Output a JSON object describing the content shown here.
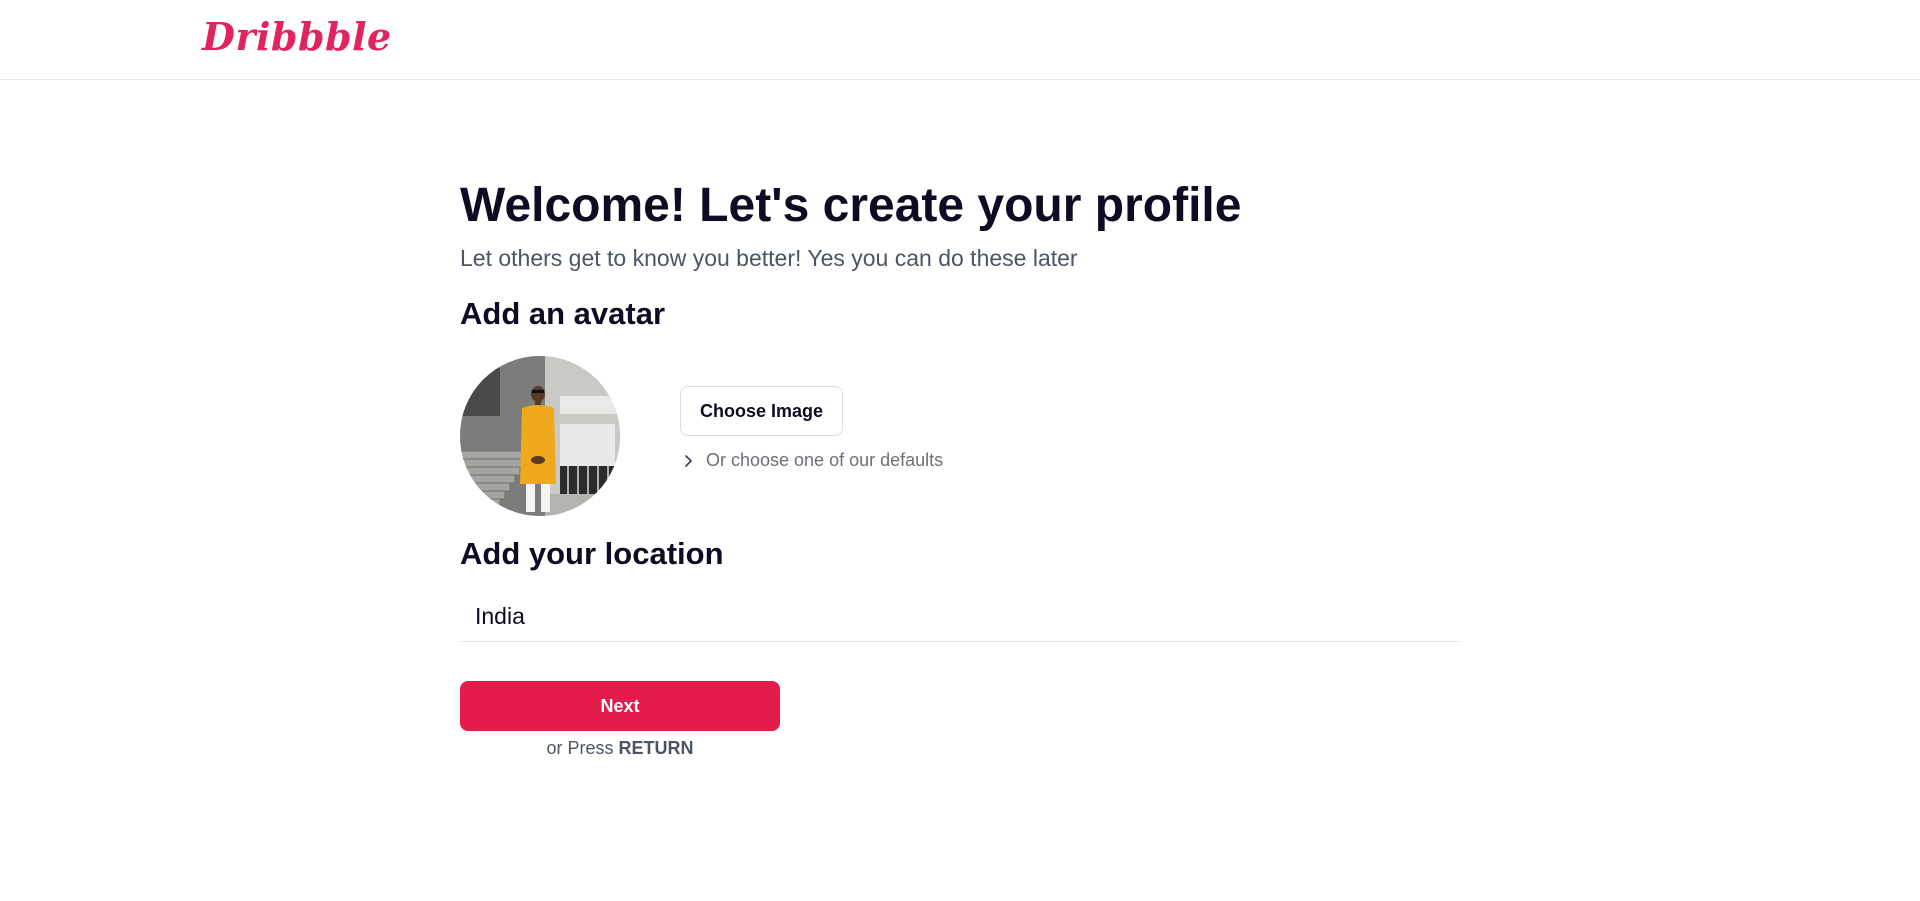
{
  "header": {
    "logo_text": "Dribbble",
    "brand_color": "#e0245e"
  },
  "main": {
    "title": "Welcome! Let's create your profile",
    "subtitle": "Let others get to know you better! Yes you can do these later",
    "avatar_section": {
      "heading": "Add an avatar",
      "choose_button_label": "Choose Image",
      "defaults_link_label": "Or choose one of our defaults",
      "defaults_icon": "chevron-right-icon"
    },
    "location_section": {
      "heading": "Add your location",
      "input_value": "India"
    },
    "next_button_label": "Next",
    "hint_prefix": "or Press",
    "hint_key": "RETURN",
    "accent_color": "#e31c4b"
  }
}
